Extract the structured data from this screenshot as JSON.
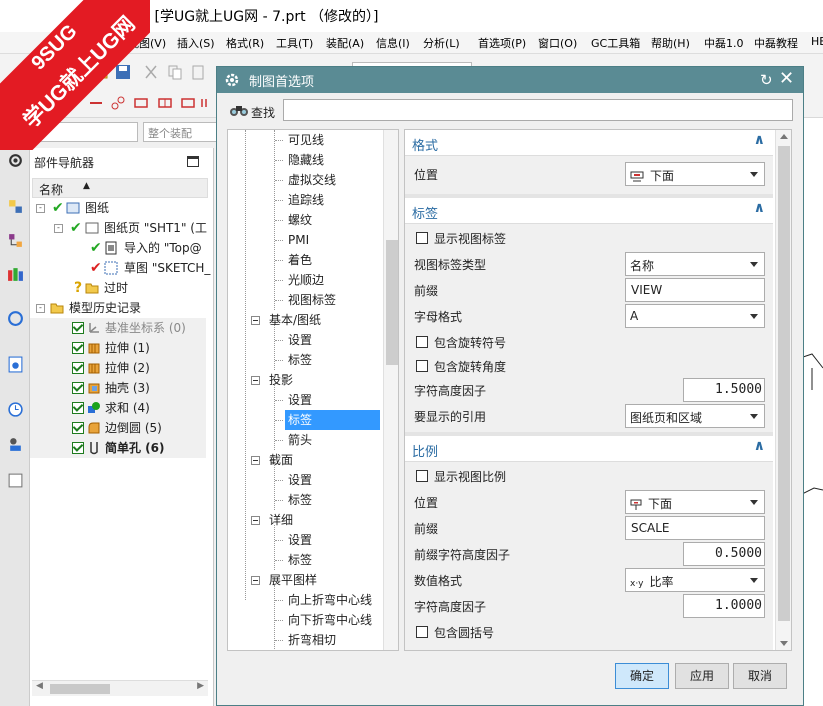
{
  "window": {
    "title": "- [学UG就上UG网 - 7.prt （修改的）]"
  },
  "menubar": {
    "items": [
      "视图(V)",
      "插入(S)",
      "格式(R)",
      "工具(T)",
      "装配(A)",
      "信息(I)",
      "分析(L)",
      "首选项(P)",
      "窗口(O)",
      "GC工具箱",
      "帮助(H)",
      "中磊1.0",
      "中磊教程",
      "HB"
    ]
  },
  "toolbar": {
    "assembly_filter_placeholder": "整个装配"
  },
  "watermark": {
    "line1": "9SUG",
    "line2": "学UG就上UG网"
  },
  "part_navigator": {
    "title": "部件导航器",
    "column_name": "名称",
    "rows": [
      {
        "label": "图纸"
      },
      {
        "label": "图纸页 \"SHT1\" (工"
      },
      {
        "label": "导入的 \"Top@"
      },
      {
        "label": "草图 \"SKETCH_"
      },
      {
        "label": "过时"
      },
      {
        "label": "模型历史记录"
      },
      {
        "label": "基准坐标系 (0)"
      },
      {
        "label": "拉伸 (1)"
      },
      {
        "label": "拉伸 (2)"
      },
      {
        "label": "抽壳 (3)"
      },
      {
        "label": "求和 (4)"
      },
      {
        "label": "边倒圆 (5)"
      },
      {
        "label": "简单孔 (6)"
      }
    ]
  },
  "dialog": {
    "title": "制图首选项",
    "find_label": "查找",
    "find_value": "",
    "categories": [
      {
        "label": "可见线"
      },
      {
        "label": "隐藏线"
      },
      {
        "label": "虚拟交线"
      },
      {
        "label": "追踪线"
      },
      {
        "label": "螺纹"
      },
      {
        "label": "PMI"
      },
      {
        "label": "着色"
      },
      {
        "label": "光顺边"
      },
      {
        "label": "视图标签"
      },
      {
        "label": "基本/图纸"
      },
      {
        "label": "设置"
      },
      {
        "label": "标签"
      },
      {
        "label": "投影"
      },
      {
        "label": "设置"
      },
      {
        "label": "标签"
      },
      {
        "label": "箭头"
      },
      {
        "label": "截面"
      },
      {
        "label": "设置"
      },
      {
        "label": "标签"
      },
      {
        "label": "详细"
      },
      {
        "label": "设置"
      },
      {
        "label": "标签"
      },
      {
        "label": "展平图样"
      },
      {
        "label": "向上折弯中心线"
      },
      {
        "label": "向下折弯中心线"
      },
      {
        "label": "折弯相切"
      }
    ],
    "groups": {
      "format": {
        "title": "格式",
        "position_label": "位置",
        "position_value": "下面"
      },
      "label": {
        "title": "标签",
        "show_view_label": "显示视图标签",
        "label_type_label": "视图标签类型",
        "label_type_value": "名称",
        "prefix_label": "前缀",
        "prefix_value": "VIEW",
        "letter_format_label": "字母格式",
        "letter_format_value": "A",
        "include_rotation_symbol": "包含旋转符号",
        "include_rotation_angle": "包含旋转角度",
        "char_height_label": "字符高度因子",
        "char_height_value": "1.5000",
        "reference_label": "要显示的引用",
        "reference_value": "图纸页和区域"
      },
      "scale": {
        "title": "比例",
        "show_view_scale": "显示视图比例",
        "position_label": "位置",
        "position_value": "下面",
        "prefix_label": "前缀",
        "prefix_value": "SCALE",
        "prefix_height_label": "前缀字符高度因子",
        "prefix_height_value": "0.5000",
        "value_format_label": "数值格式",
        "value_format_icon": "x·y",
        "value_format_value": "比率",
        "char_height_label": "字符高度因子",
        "char_height_value": "1.0000",
        "include_parens": "包含圆括号"
      }
    },
    "buttons": {
      "ok": "确定",
      "apply": "应用",
      "cancel": "取消"
    }
  },
  "colors": {
    "dialog_title_bar": "#5a8b94",
    "group_title": "#2b6ca3",
    "selection": "#3399ff",
    "watermark": "#e31b23"
  }
}
